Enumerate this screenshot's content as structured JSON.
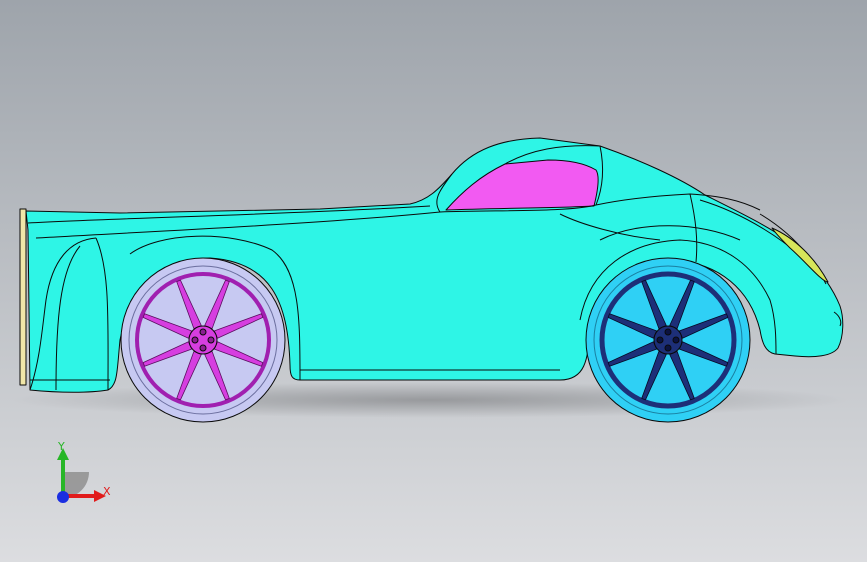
{
  "viewport": {
    "background_top": "#9ea4ab",
    "background_bottom": "#dcdde0"
  },
  "model": {
    "body_color": "#2ef5e6",
    "window_color": "#f25af2",
    "front_wheel_hub_color": "#d63ee0",
    "front_tire_color": "#c7c9f2",
    "rear_wheel_hub_color": "#1d2f78",
    "rear_tire_color": "#2fd0f5",
    "trim_color": "#f0e6a8",
    "headlight_color": "#d7e65a"
  },
  "triad": {
    "x_label": "X",
    "y_label": "Y",
    "x_color": "#e11b1b",
    "y_color": "#27b627",
    "z_color": "#1b2ee1"
  }
}
